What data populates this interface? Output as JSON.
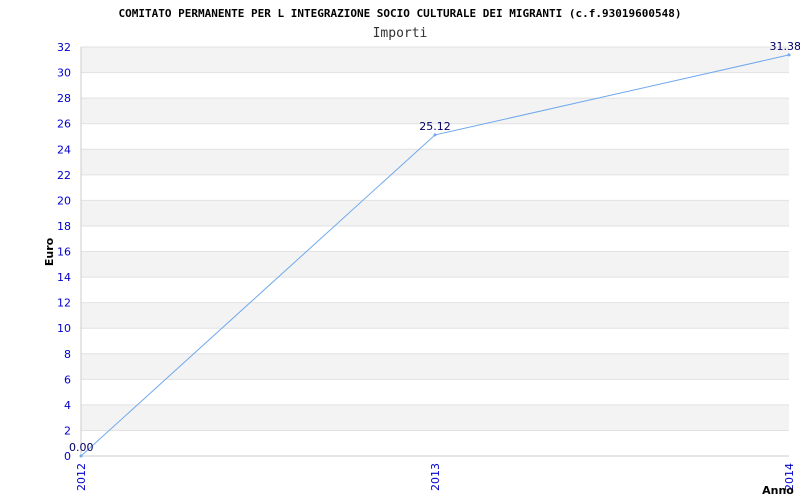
{
  "chart_data": {
    "type": "line",
    "title": "COMITATO PERMANENTE PER L INTEGRAZIONE SOCIO CULTURALE DEI MIGRANTI (c.f.93019600548)",
    "subtitle": "Importi",
    "xlabel": "Anno",
    "ylabel": "Euro",
    "categories": [
      "2012",
      "2013",
      "2014"
    ],
    "series": [
      {
        "values": [
          0.0,
          25.12,
          31.38
        ],
        "labels": [
          "0.00",
          "25.12",
          "31.38"
        ]
      }
    ],
    "ylim": [
      0,
      32
    ],
    "yticks": [
      0,
      2,
      4,
      6,
      8,
      10,
      12,
      14,
      16,
      18,
      20,
      22,
      24,
      26,
      28,
      30,
      32
    ],
    "grid": true,
    "line_color": "#6fa8ec",
    "band_colors": [
      "#f3f3f3",
      "#ffffff"
    ],
    "tick_color": "#0000cc"
  }
}
